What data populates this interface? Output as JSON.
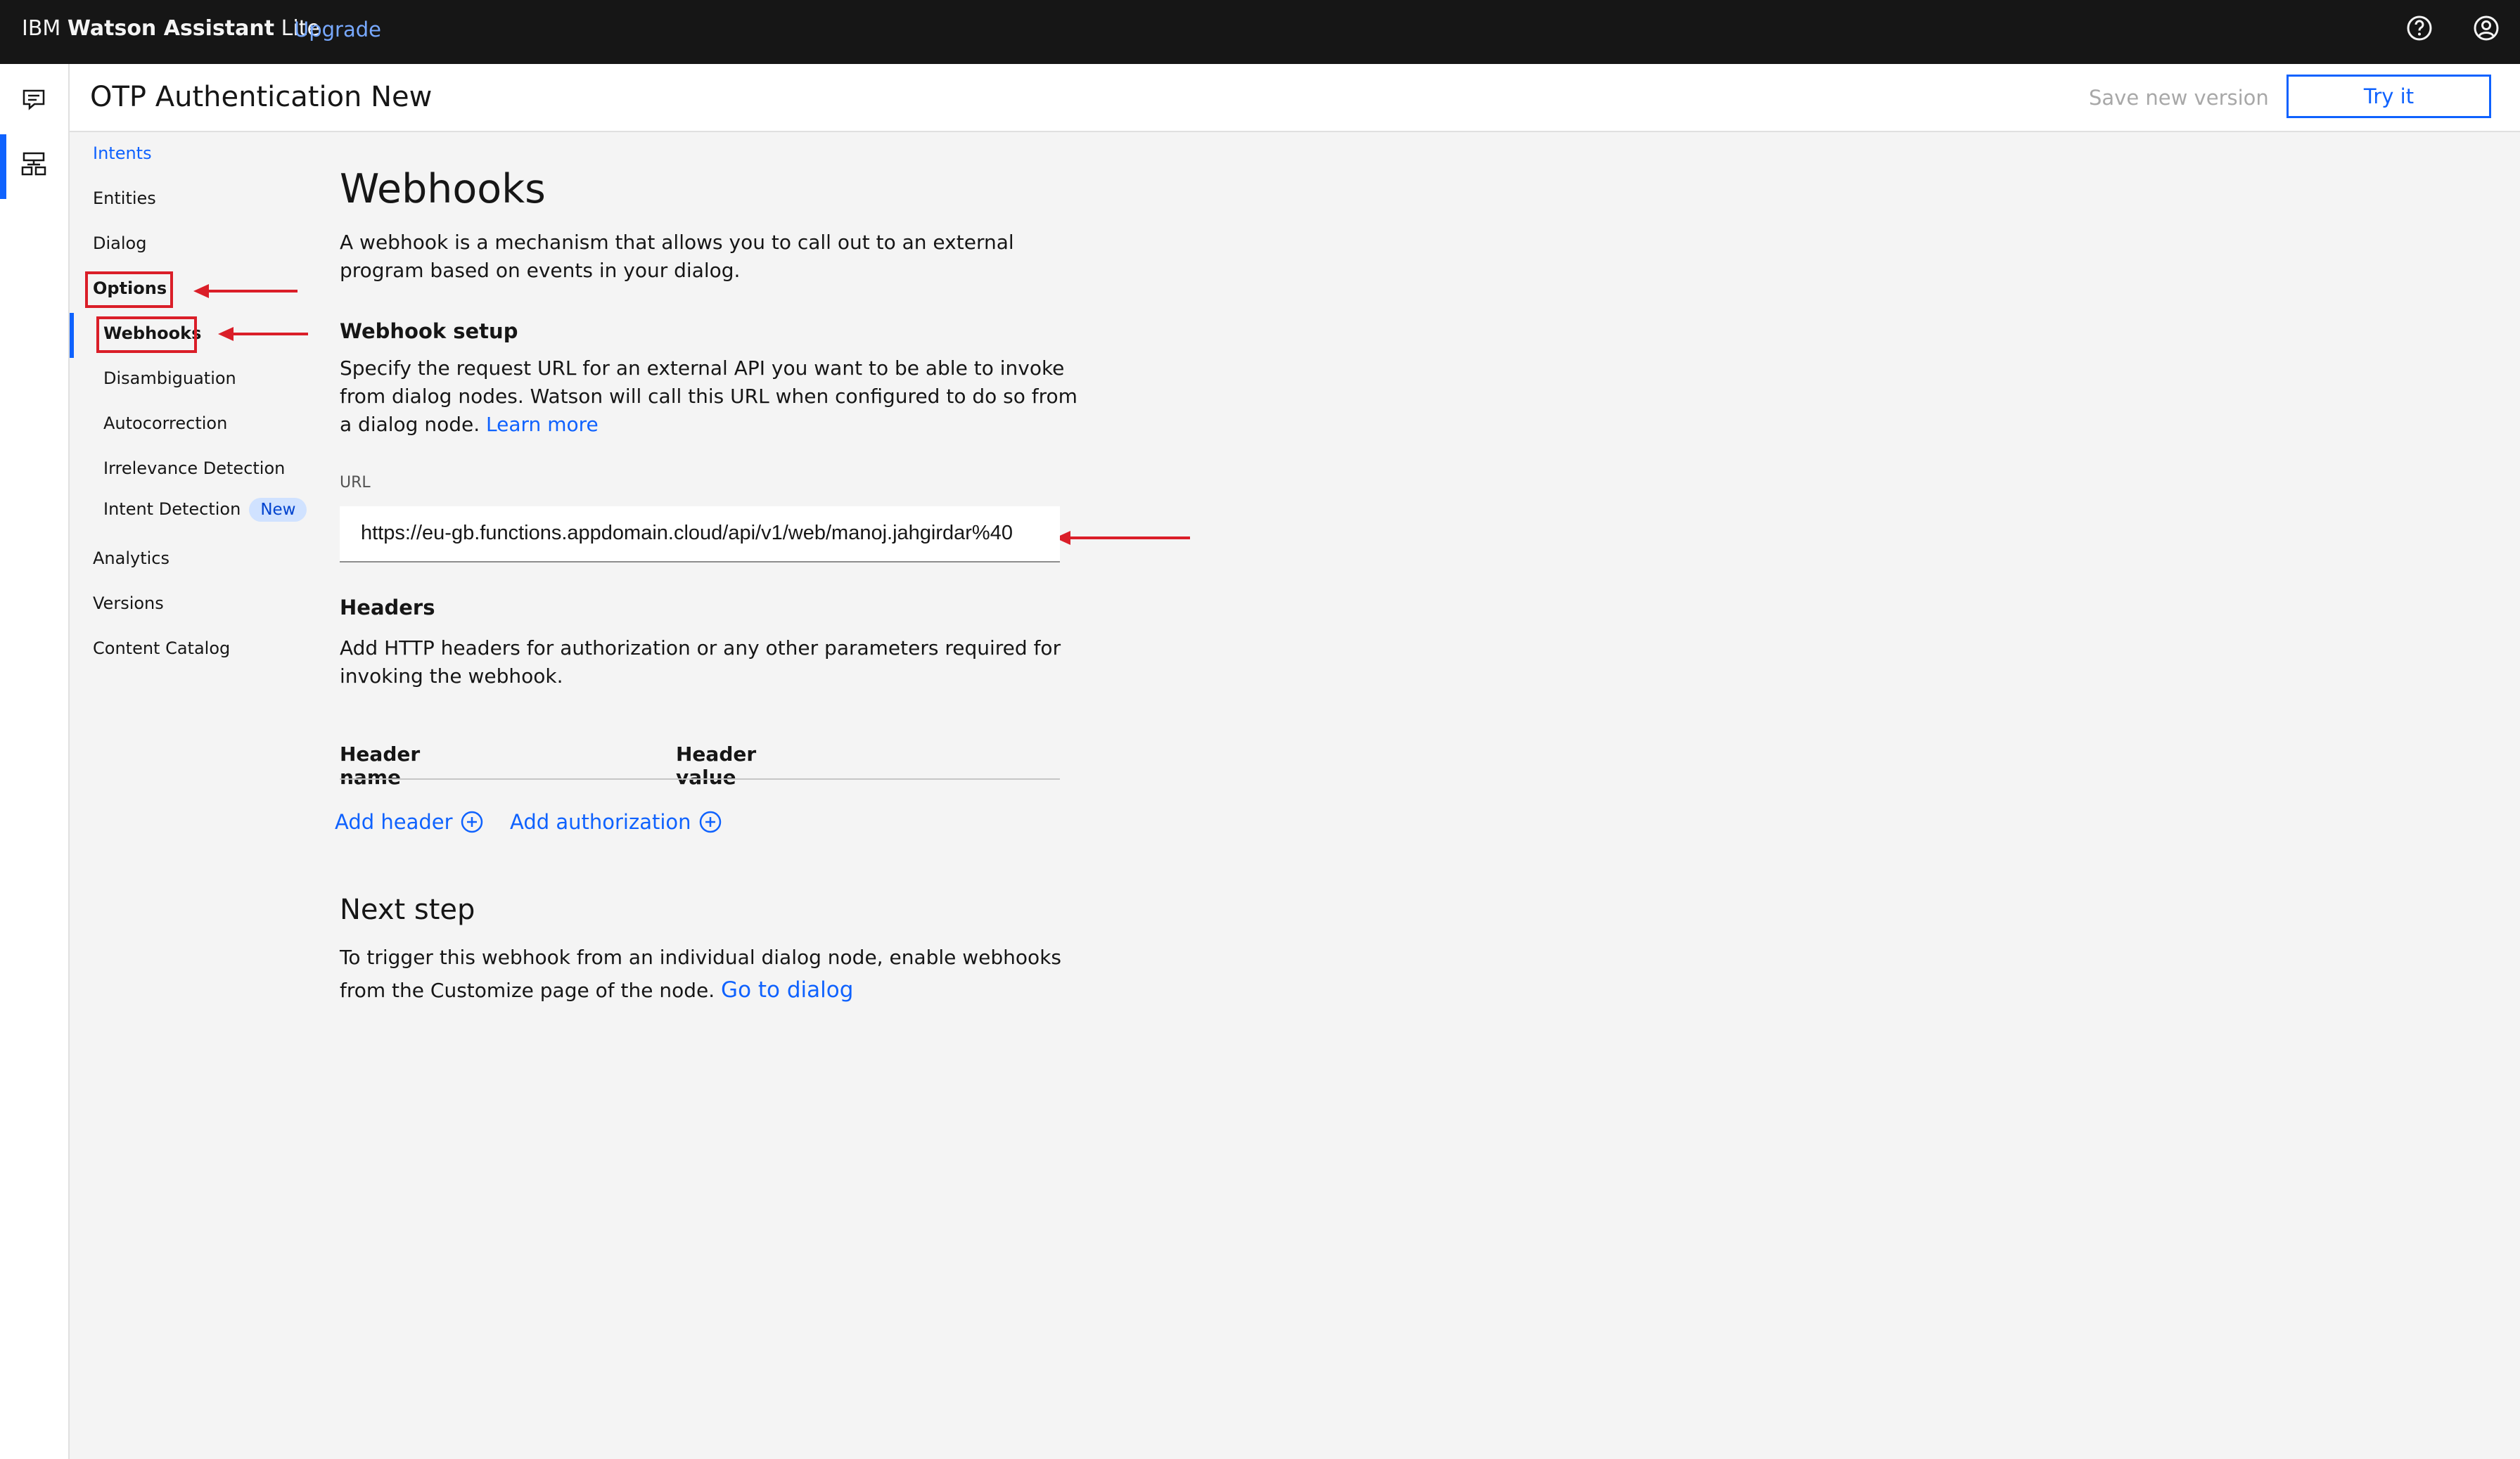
{
  "topbar": {
    "brand_prefix": "IBM",
    "brand_name": "Watson Assistant",
    "brand_plan": "Lite",
    "upgrade": "Upgrade",
    "icons": [
      "help-icon",
      "user-avatar-icon"
    ]
  },
  "rail": {
    "icons": [
      "chat-icon",
      "skills-icon"
    ]
  },
  "header": {
    "title": "OTP Authentication New",
    "save_version": "Save new version",
    "try_it": "Try it"
  },
  "nav": {
    "intents": "Intents",
    "entities": "Entities",
    "dialog": "Dialog",
    "options": "Options",
    "webhooks": "Webhooks",
    "disambiguation": "Disambiguation",
    "autocorrection": "Autocorrection",
    "irrelevance": "Irrelevance Detection",
    "intent_detection": "Intent Detection",
    "new_tag": "New",
    "analytics": "Analytics",
    "versions": "Versions",
    "content_catalog": "Content Catalog"
  },
  "main": {
    "title": "Webhooks",
    "description": "A webhook is a mechanism that allows you to call out to an external program based on events in your dialog.",
    "setup_title": "Webhook setup",
    "setup_text": "Specify the request URL for an external API you want to be able to invoke from dialog nodes. Watson will call this URL when configured to do so from a dialog node.",
    "learn_more": "Learn more",
    "url_label": "URL",
    "url_value": "https://eu-gb.functions.appdomain.cloud/api/v1/web/manoj.jahgirdar%40",
    "headers_title": "Headers",
    "headers_text": "Add HTTP headers for authorization or any other parameters required for invoking the webhook.",
    "col_name": "Header name",
    "col_value": "Header value",
    "add_header": "Add header",
    "add_auth": "Add authorization",
    "next_title": "Next step",
    "next_text": "To trigger this webhook from an individual dialog node, enable webhooks from the Customize page of the node.",
    "go_dialog": "Go to dialog"
  },
  "colors": {
    "accent": "#0f62fe",
    "annotation": "#da1e28",
    "topbar": "#161616"
  }
}
